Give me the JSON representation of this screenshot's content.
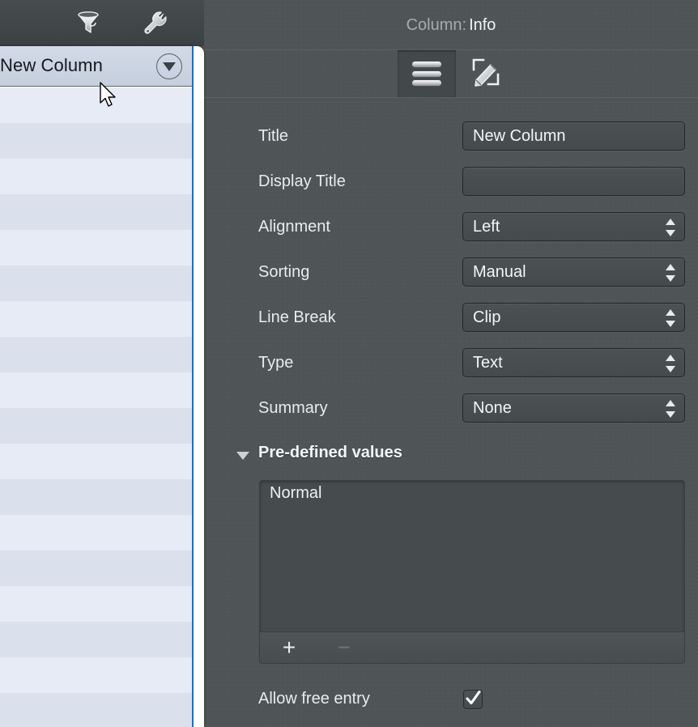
{
  "left_panel": {
    "toolbar": {
      "filter_icon": "filter-funnel-icon",
      "wrench_icon": "wrench-icon"
    },
    "table": {
      "column_header_title": "New Column",
      "header_popup_icon": "chevron-down-circle-icon",
      "row_count": 18
    }
  },
  "inspector": {
    "title_prefix": "Column:",
    "title_value": "Info",
    "tabs": [
      {
        "id": "list",
        "icon": "list-rows-icon",
        "active": true
      },
      {
        "id": "edit",
        "icon": "pencil-edit-icon",
        "active": false
      }
    ],
    "fields": [
      {
        "label": "Title",
        "type": "text",
        "value": "New Column",
        "placeholder": ""
      },
      {
        "label": "Display Title",
        "type": "text",
        "value": "",
        "placeholder": ""
      },
      {
        "label": "Alignment",
        "type": "select",
        "value": "Left"
      },
      {
        "label": "Sorting",
        "type": "select",
        "value": "Manual"
      },
      {
        "label": "Line Break",
        "type": "select",
        "value": "Clip"
      },
      {
        "label": "Type",
        "type": "select",
        "value": "Text"
      },
      {
        "label": "Summary",
        "type": "select",
        "value": "None"
      }
    ],
    "predefined": {
      "section_label": "Pre-defined values",
      "expanded": true,
      "values": [
        "Normal"
      ],
      "add_label": "+",
      "remove_label": "−"
    },
    "free_entry": {
      "label": "Allow free entry",
      "checked": true
    }
  },
  "colors": {
    "panel_bg": "#4f5456",
    "toolbar_bg": "#3e4345",
    "row_odd": "#e6ebf5",
    "row_even": "#dae0ec",
    "header_blue_border": "#2f6ab0",
    "text_primary": "#f2f4f5",
    "text_dim": "#a6abad"
  }
}
